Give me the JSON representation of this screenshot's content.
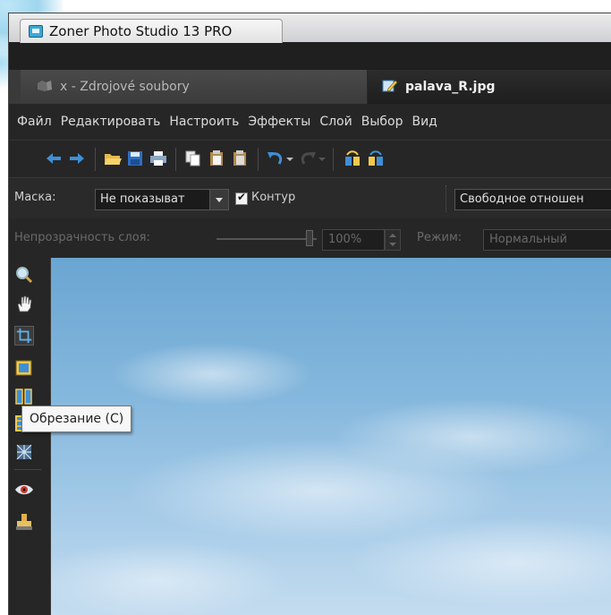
{
  "window": {
    "title": "Zoner Photo Studio 13 PRO"
  },
  "tabs": [
    {
      "label": "x - Zdrojové soubory",
      "active": false
    },
    {
      "label": "palava_R.jpg",
      "active": true
    }
  ],
  "menu": {
    "items": [
      "Файл",
      "Редактировать",
      "Настроить",
      "Эффекты",
      "Слой",
      "Выбор",
      "Вид"
    ]
  },
  "toolbar": {
    "buttons": [
      "back-arrow-icon",
      "forward-arrow-icon",
      "open-folder-icon",
      "save-icon",
      "print-icon",
      "copy-icon",
      "paste-icon",
      "paste-special-icon",
      "undo-icon",
      "redo-icon",
      "rotate-left-icon",
      "rotate-right-icon"
    ]
  },
  "options": {
    "mask_label": "Маска:",
    "mask_value": "Не показыват",
    "outline_label": "Контур",
    "outline_checked": true,
    "ratio_value": "Свободное отношен"
  },
  "layer": {
    "opacity_label": "Непрозрачность слоя:",
    "opacity_value": "100%",
    "mode_label": "Режим:",
    "mode_value": "Нормальный"
  },
  "tools": [
    "zoom-icon",
    "hand-icon",
    "crop-icon",
    "select-rect-icon",
    "straighten-icon",
    "frame-icon",
    "effect-brush-icon",
    "red-eye-icon",
    "stamp-icon"
  ],
  "tooltip": {
    "text": "Обрезание (C)"
  },
  "colors": {
    "accent": "#3aa9d8",
    "panel": "#262626",
    "sky": "#86b8dd"
  }
}
